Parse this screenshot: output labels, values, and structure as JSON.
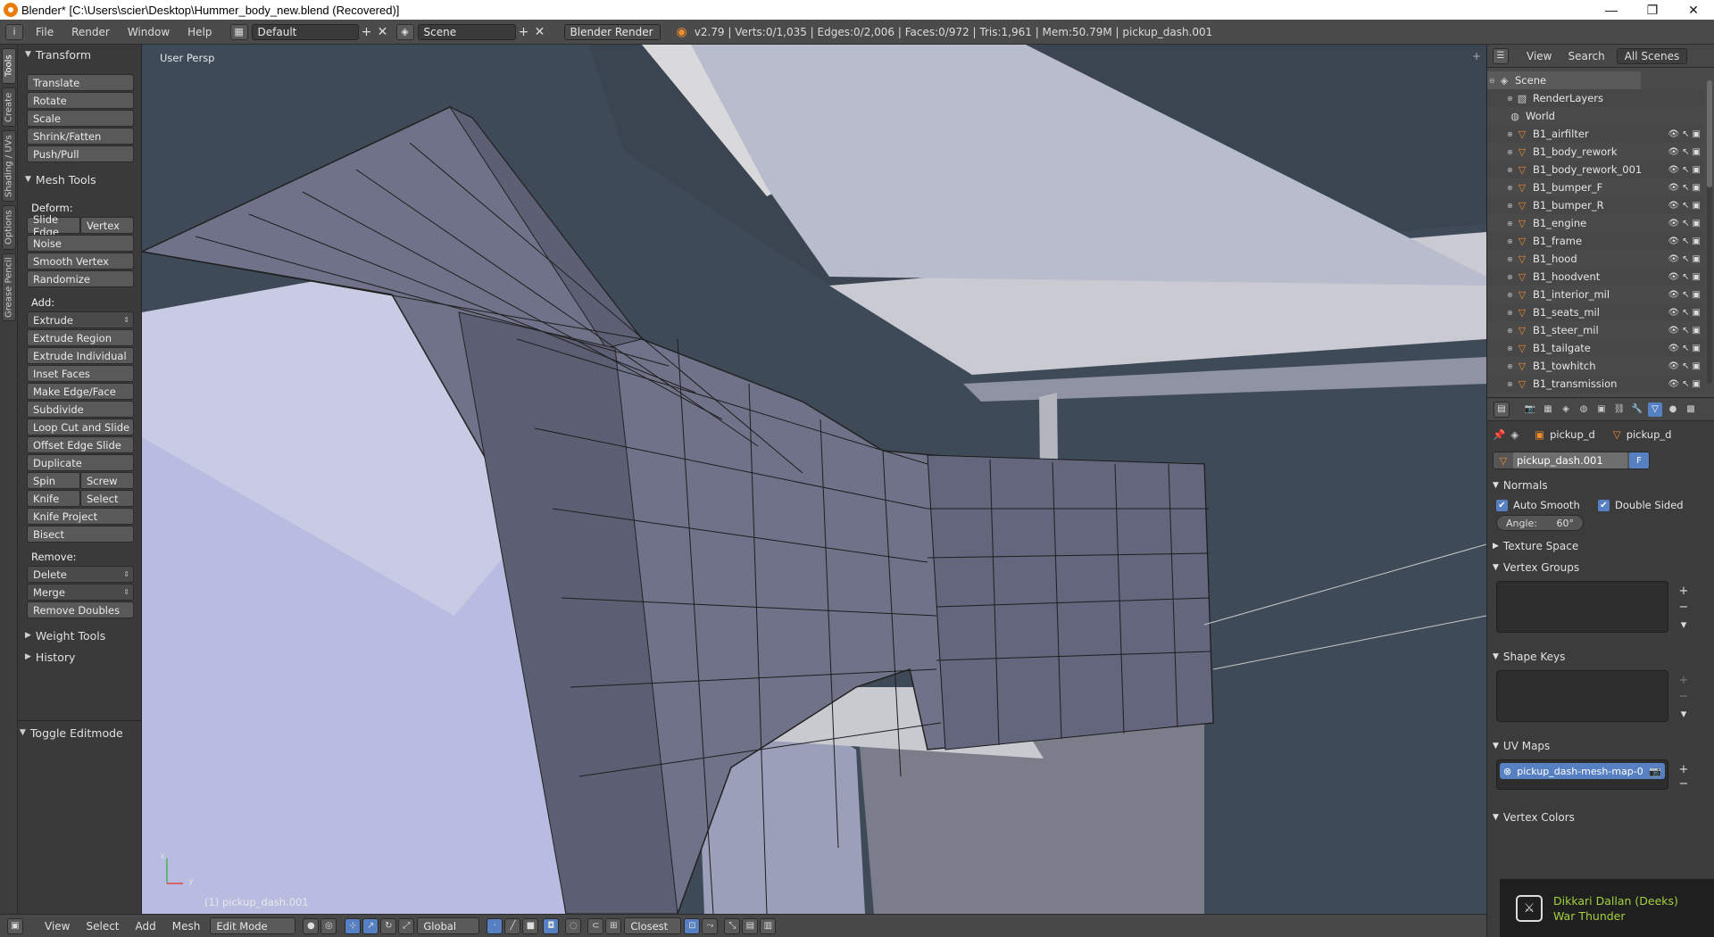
{
  "window": {
    "title": "Blender* [C:\\Users\\scier\\Desktop\\Hummer_body_new.blend (Recovered)]",
    "minimize": "—",
    "maximize": "❐",
    "close": "✕"
  },
  "info_header": {
    "menus": [
      "File",
      "Render",
      "Window",
      "Help"
    ],
    "screen_layout": "Default",
    "scene": "Scene",
    "render_engine": "Blender Render",
    "stats": "v2.79 | Verts:0/1,035 | Edges:0/2,006 | Faces:0/972 | Tris:1,961 | Mem:50.79M | pickup_dash.001"
  },
  "left_tabs": [
    "Tools",
    "Create",
    "Shading / UVs",
    "Options",
    "Grease Pencil"
  ],
  "tool_shelf": {
    "transform": {
      "title": "Transform",
      "buttons": [
        "Translate",
        "Rotate",
        "Scale",
        "Shrink/Fatten",
        "Push/Pull"
      ]
    },
    "mesh_tools": {
      "title": "Mesh Tools",
      "deform_label": "Deform:",
      "slide_edge": "Slide Edge",
      "vertex": "Vertex",
      "deform_buttons": [
        "Noise",
        "Smooth Vertex",
        "Randomize"
      ],
      "add_label": "Add:",
      "extrude": "Extrude",
      "add_buttons": [
        "Extrude Region",
        "Extrude Individual",
        "Inset Faces",
        "Make Edge/Face",
        "Subdivide",
        "Loop Cut and Slide",
        "Offset Edge Slide",
        "Duplicate"
      ],
      "spin": "Spin",
      "screw": "Screw",
      "knife": "Knife",
      "select": "Select",
      "knife_project": "Knife Project",
      "bisect": "Bisect",
      "remove_label": "Remove:",
      "delete": "Delete",
      "merge": "Merge",
      "remove_doubles": "Remove Doubles"
    },
    "weight_tools": "Weight Tools",
    "history": "History",
    "toggle_editmode": "Toggle Editmode"
  },
  "viewport": {
    "view_label": "User Persp",
    "object_label": "(1) pickup_dash.001",
    "axis_x": "x",
    "axis_y": "y"
  },
  "bottom_header": {
    "menus": [
      "View",
      "Select",
      "Add",
      "Mesh"
    ],
    "mode": "Edit Mode",
    "orientation": "Global",
    "snap_target": "Closest"
  },
  "outliner": {
    "menus": [
      "View",
      "Search"
    ],
    "filter": "All Scenes",
    "scene": "Scene",
    "render_layers": "RenderLayers",
    "world": "World",
    "objects": [
      "B1_airfilter",
      "B1_body_rework",
      "B1_body_rework_001",
      "B1_bumper_F",
      "B1_bumper_R",
      "B1_engine",
      "B1_frame",
      "B1_hood",
      "B1_hoodvent",
      "B1_interior_mil",
      "B1_seats_mil",
      "B1_steer_mil",
      "B1_tailgate",
      "B1_towhitch",
      "B1_transmission"
    ]
  },
  "properties": {
    "object_name": "pickup_d",
    "mesh_name": "pickup_d",
    "datablock": "pickup_dash.001",
    "fake_user": "F",
    "normals": {
      "title": "Normals",
      "auto_smooth": "Auto Smooth",
      "double_sided": "Double Sided",
      "angle": "Angle:",
      "angle_value": "60°"
    },
    "texture_space": "Texture Space",
    "vertex_groups": "Vertex Groups",
    "shape_keys": "Shape Keys",
    "uv_maps": "UV Maps",
    "uv_map_item": "pickup_dash-mesh-map-0",
    "vertex_colors": "Vertex Colors"
  },
  "notification": {
    "line1": "Dikkari Dallan (Deeks)",
    "line2": "War Thunder"
  },
  "colors": {
    "accent": "#5680c2",
    "object_icon": "#f08d2d",
    "notification_text": "#a4d13e",
    "viewport_bg": "#3b4552"
  }
}
